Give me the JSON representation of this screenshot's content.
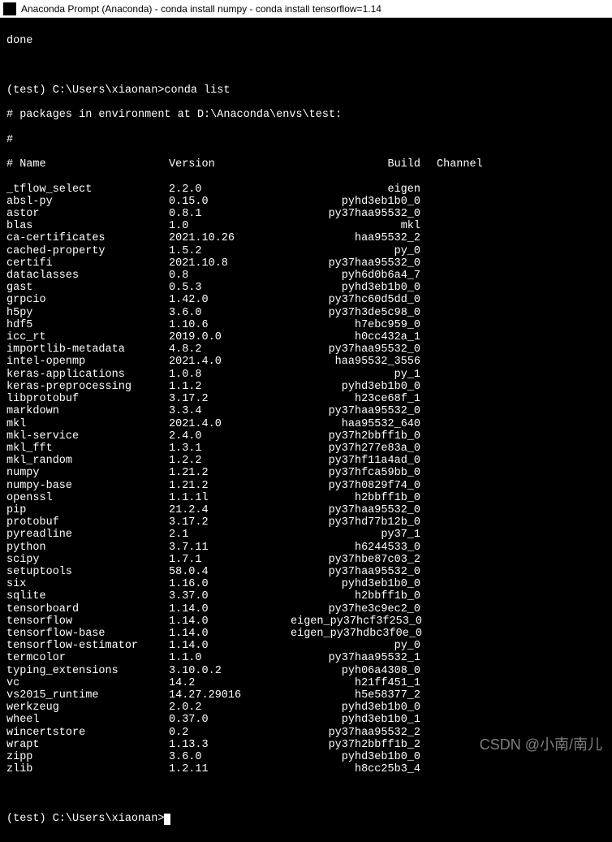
{
  "titlebar": {
    "text": "Anaconda Prompt (Anaconda) - conda  install numpy - conda  install tensorflow=1.14"
  },
  "terminal": {
    "done": "done",
    "prompt1": "(test) C:\\Users\\xiaonan>conda list",
    "comment1": "# packages in environment at D:\\Anaconda\\envs\\test:",
    "comment2": "#",
    "header": {
      "name": "# Name",
      "version": "Version",
      "build": "Build",
      "channel": "Channel"
    },
    "packages": [
      {
        "name": "_tflow_select",
        "version": "2.2.0",
        "build": "eigen",
        "channel": ""
      },
      {
        "name": "absl-py",
        "version": "0.15.0",
        "build": "pyhd3eb1b0_0",
        "channel": ""
      },
      {
        "name": "astor",
        "version": "0.8.1",
        "build": "py37haa95532_0",
        "channel": ""
      },
      {
        "name": "blas",
        "version": "1.0",
        "build": "mkl",
        "channel": ""
      },
      {
        "name": "ca-certificates",
        "version": "2021.10.26",
        "build": "haa95532_2",
        "channel": ""
      },
      {
        "name": "cached-property",
        "version": "1.5.2",
        "build": "py_0",
        "channel": ""
      },
      {
        "name": "certifi",
        "version": "2021.10.8",
        "build": "py37haa95532_0",
        "channel": ""
      },
      {
        "name": "dataclasses",
        "version": "0.8",
        "build": "pyh6d0b6a4_7",
        "channel": ""
      },
      {
        "name": "gast",
        "version": "0.5.3",
        "build": "pyhd3eb1b0_0",
        "channel": ""
      },
      {
        "name": "grpcio",
        "version": "1.42.0",
        "build": "py37hc60d5dd_0",
        "channel": ""
      },
      {
        "name": "h5py",
        "version": "3.6.0",
        "build": "py37h3de5c98_0",
        "channel": ""
      },
      {
        "name": "hdf5",
        "version": "1.10.6",
        "build": "h7ebc959_0",
        "channel": ""
      },
      {
        "name": "icc_rt",
        "version": "2019.0.0",
        "build": "h0cc432a_1",
        "channel": ""
      },
      {
        "name": "importlib-metadata",
        "version": "4.8.2",
        "build": "py37haa95532_0",
        "channel": ""
      },
      {
        "name": "intel-openmp",
        "version": "2021.4.0",
        "build": "haa95532_3556",
        "channel": ""
      },
      {
        "name": "keras-applications",
        "version": "1.0.8",
        "build": "py_1",
        "channel": ""
      },
      {
        "name": "keras-preprocessing",
        "version": "1.1.2",
        "build": "pyhd3eb1b0_0",
        "channel": ""
      },
      {
        "name": "libprotobuf",
        "version": "3.17.2",
        "build": "h23ce68f_1",
        "channel": ""
      },
      {
        "name": "markdown",
        "version": "3.3.4",
        "build": "py37haa95532_0",
        "channel": ""
      },
      {
        "name": "mkl",
        "version": "2021.4.0",
        "build": "haa95532_640",
        "channel": ""
      },
      {
        "name": "mkl-service",
        "version": "2.4.0",
        "build": "py37h2bbff1b_0",
        "channel": ""
      },
      {
        "name": "mkl_fft",
        "version": "1.3.1",
        "build": "py37h277e83a_0",
        "channel": ""
      },
      {
        "name": "mkl_random",
        "version": "1.2.2",
        "build": "py37hf11a4ad_0",
        "channel": ""
      },
      {
        "name": "numpy",
        "version": "1.21.2",
        "build": "py37hfca59bb_0",
        "channel": ""
      },
      {
        "name": "numpy-base",
        "version": "1.21.2",
        "build": "py37h0829f74_0",
        "channel": ""
      },
      {
        "name": "openssl",
        "version": "1.1.1l",
        "build": "h2bbff1b_0",
        "channel": ""
      },
      {
        "name": "pip",
        "version": "21.2.4",
        "build": "py37haa95532_0",
        "channel": ""
      },
      {
        "name": "protobuf",
        "version": "3.17.2",
        "build": "py37hd77b12b_0",
        "channel": ""
      },
      {
        "name": "pyreadline",
        "version": "2.1",
        "build": "py37_1",
        "channel": ""
      },
      {
        "name": "python",
        "version": "3.7.11",
        "build": "h6244533_0",
        "channel": ""
      },
      {
        "name": "scipy",
        "version": "1.7.1",
        "build": "py37hbe87c03_2",
        "channel": ""
      },
      {
        "name": "setuptools",
        "version": "58.0.4",
        "build": "py37haa95532_0",
        "channel": ""
      },
      {
        "name": "six",
        "version": "1.16.0",
        "build": "pyhd3eb1b0_0",
        "channel": ""
      },
      {
        "name": "sqlite",
        "version": "3.37.0",
        "build": "h2bbff1b_0",
        "channel": ""
      },
      {
        "name": "tensorboard",
        "version": "1.14.0",
        "build": "py37he3c9ec2_0",
        "channel": ""
      },
      {
        "name": "tensorflow",
        "version": "1.14.0",
        "build": "eigen_py37hcf3f253_0",
        "channel": ""
      },
      {
        "name": "tensorflow-base",
        "version": "1.14.0",
        "build": "eigen_py37hdbc3f0e_0",
        "channel": ""
      },
      {
        "name": "tensorflow-estimator",
        "version": "1.14.0",
        "build": "py_0",
        "channel": ""
      },
      {
        "name": "termcolor",
        "version": "1.1.0",
        "build": "py37haa95532_1",
        "channel": ""
      },
      {
        "name": "typing_extensions",
        "version": "3.10.0.2",
        "build": "pyh06a4308_0",
        "channel": ""
      },
      {
        "name": "vc",
        "version": "14.2",
        "build": "h21ff451_1",
        "channel": ""
      },
      {
        "name": "vs2015_runtime",
        "version": "14.27.29016",
        "build": "h5e58377_2",
        "channel": ""
      },
      {
        "name": "werkzeug",
        "version": "2.0.2",
        "build": "pyhd3eb1b0_0",
        "channel": ""
      },
      {
        "name": "wheel",
        "version": "0.37.0",
        "build": "pyhd3eb1b0_1",
        "channel": ""
      },
      {
        "name": "wincertstore",
        "version": "0.2",
        "build": "py37haa95532_2",
        "channel": ""
      },
      {
        "name": "wrapt",
        "version": "1.13.3",
        "build": "py37h2bbff1b_2",
        "channel": ""
      },
      {
        "name": "zipp",
        "version": "3.6.0",
        "build": "pyhd3eb1b0_0",
        "channel": ""
      },
      {
        "name": "zlib",
        "version": "1.2.11",
        "build": "h8cc25b3_4",
        "channel": ""
      }
    ],
    "prompt2_prefix": "(test) C:\\Users\\xiaonan>"
  },
  "watermark": "CSDN @小南/南儿"
}
